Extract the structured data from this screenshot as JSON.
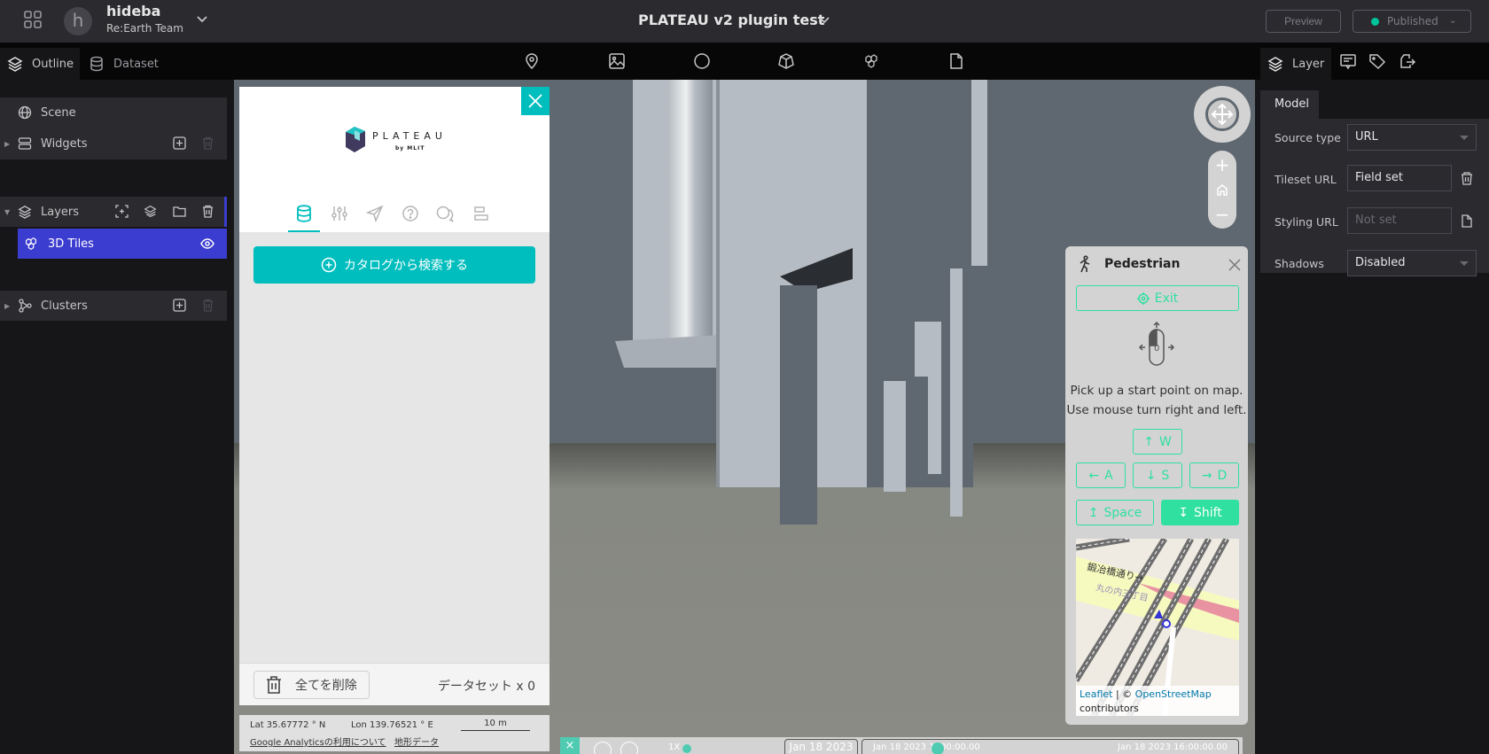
{
  "header": {
    "user_initial": "h",
    "user_name": "hideba",
    "team_name": "Re:Earth Team",
    "project_title": "PLATEAU v2 plugin test",
    "preview_label": "Preview",
    "publish_status": "Published",
    "publish_status_color": "#00c49a"
  },
  "left_tabs": {
    "outline": "Outline",
    "dataset": "Dataset"
  },
  "toolbar_icons": [
    "marker-icon",
    "photo-overlay-icon",
    "sphere-icon",
    "model-icon",
    "3d-tiles-icon",
    "file-icon"
  ],
  "outline": {
    "scene": "Scene",
    "widgets": "Widgets",
    "layers": "Layers",
    "layer_items": [
      {
        "label": "3D Tiles",
        "visible": true,
        "selected": true
      }
    ],
    "clusters": "Clusters"
  },
  "plugin": {
    "logo_text": "PLATEAU",
    "logo_sub": "by MLIT",
    "tabs": [
      "dataset",
      "settings",
      "share",
      "help",
      "feedback",
      "template"
    ],
    "search_button": "カタログから検索する",
    "clear_all": "全てを削除",
    "dataset_count": "データセット x 0",
    "lat": "Lat 35.67772 ° N",
    "lon": "Lon 139.76521 ° E",
    "scale": "10 m",
    "ga_link": "Google Analyticsの利用について",
    "terrain_link": "地形データ",
    "accent": "#00bebe"
  },
  "pedestrian": {
    "title": "Pedestrian",
    "exit_label": "Exit",
    "mouse_indicator": "0",
    "help_line1": "Pick up a start point on map.",
    "help_line2": "Use mouse turn right and left.",
    "keys": {
      "w": {
        "arrow": "↑",
        "label": "W"
      },
      "a": {
        "arrow": "←",
        "label": "A"
      },
      "s": {
        "arrow": "↓",
        "label": "S"
      },
      "d": {
        "arrow": "→",
        "label": "D"
      },
      "space": {
        "arrow": "↥",
        "label": "Space"
      },
      "shift": {
        "arrow": "↧",
        "label": "Shift"
      }
    },
    "minimap": {
      "street_label": "鍛冶橋通り→",
      "area_label": "丸の内三丁目",
      "attrib_leaflet": "Leaflet",
      "attrib_sep": " | © ",
      "attrib_osm": "OpenStreetMap",
      "attrib_contrib": "contributors"
    },
    "accent": "#2fe0a0"
  },
  "timeline": {
    "close": "×",
    "speed": "1X",
    "current_date": "Jan 18 2023",
    "start_time": "Jan 18 2023 1 :00:00.00",
    "end_time": "Jan 18 2023 16:00:00.00"
  },
  "right_tabs": {
    "layer": "Layer"
  },
  "properties": {
    "section": "Model",
    "source_type_label": "Source type",
    "source_type_value": "URL",
    "tileset_label": "Tileset URL",
    "tileset_value": "Field set",
    "styling_label": "Styling URL",
    "styling_placeholder": "Not set",
    "shadows_label": "Shadows",
    "shadows_value": "Disabled"
  }
}
